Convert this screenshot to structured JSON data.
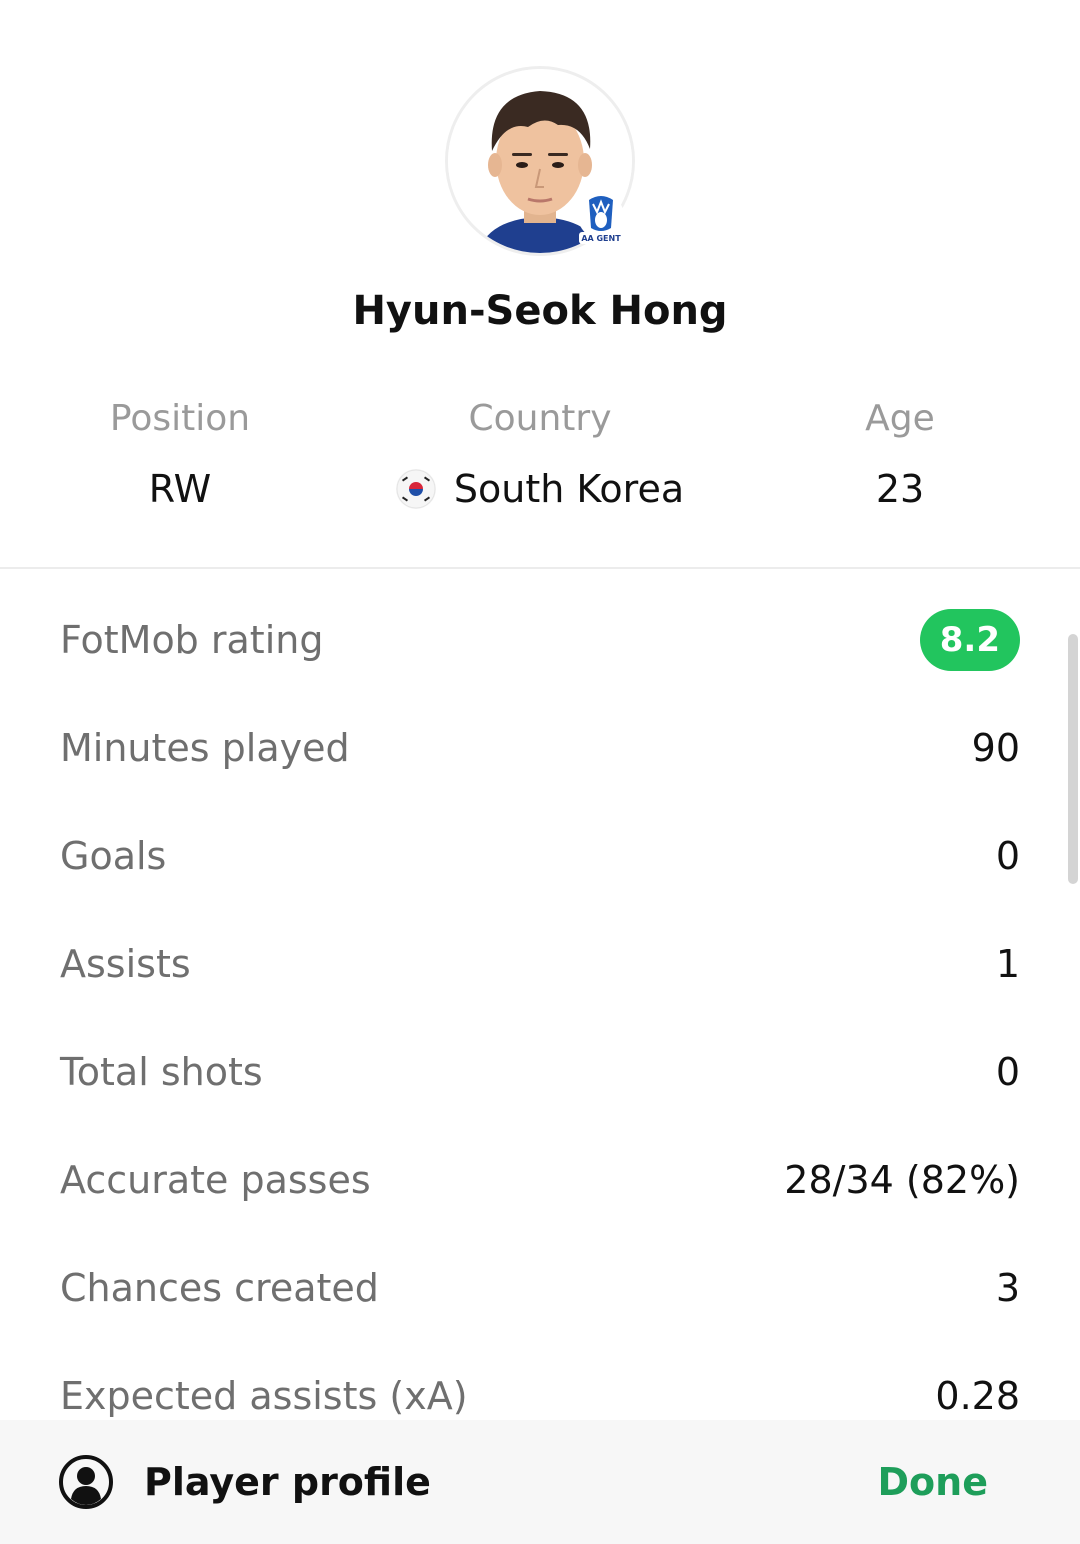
{
  "player": {
    "name": "Hyun-Seok Hong",
    "club_badge_text": "AA GENT"
  },
  "info": {
    "position": {
      "label": "Position",
      "value": "RW"
    },
    "country": {
      "label": "Country",
      "value": "South Korea"
    },
    "age": {
      "label": "Age",
      "value": "23"
    }
  },
  "stats": {
    "rating": {
      "label": "FotMob rating",
      "value": "8.2"
    },
    "minutes": {
      "label": "Minutes played",
      "value": "90"
    },
    "goals": {
      "label": "Goals",
      "value": "0"
    },
    "assists": {
      "label": "Assists",
      "value": "1"
    },
    "shots": {
      "label": "Total shots",
      "value": "0"
    },
    "passes": {
      "label": "Accurate passes",
      "value": "28/34 (82%)"
    },
    "chances": {
      "label": "Chances created",
      "value": "3"
    },
    "xa": {
      "label": "Expected assists (xA)",
      "value": "0.28"
    }
  },
  "footer": {
    "profile_label": "Player profile",
    "done_label": "Done"
  },
  "colors": {
    "rating_green": "#22c55e",
    "done_green": "#1e9e5a",
    "label_gray": "#6f6f6f"
  },
  "icons": {
    "profile": "person-circle-icon",
    "flag": "south-korea-flag-icon",
    "badge": "club-badge-icon"
  }
}
